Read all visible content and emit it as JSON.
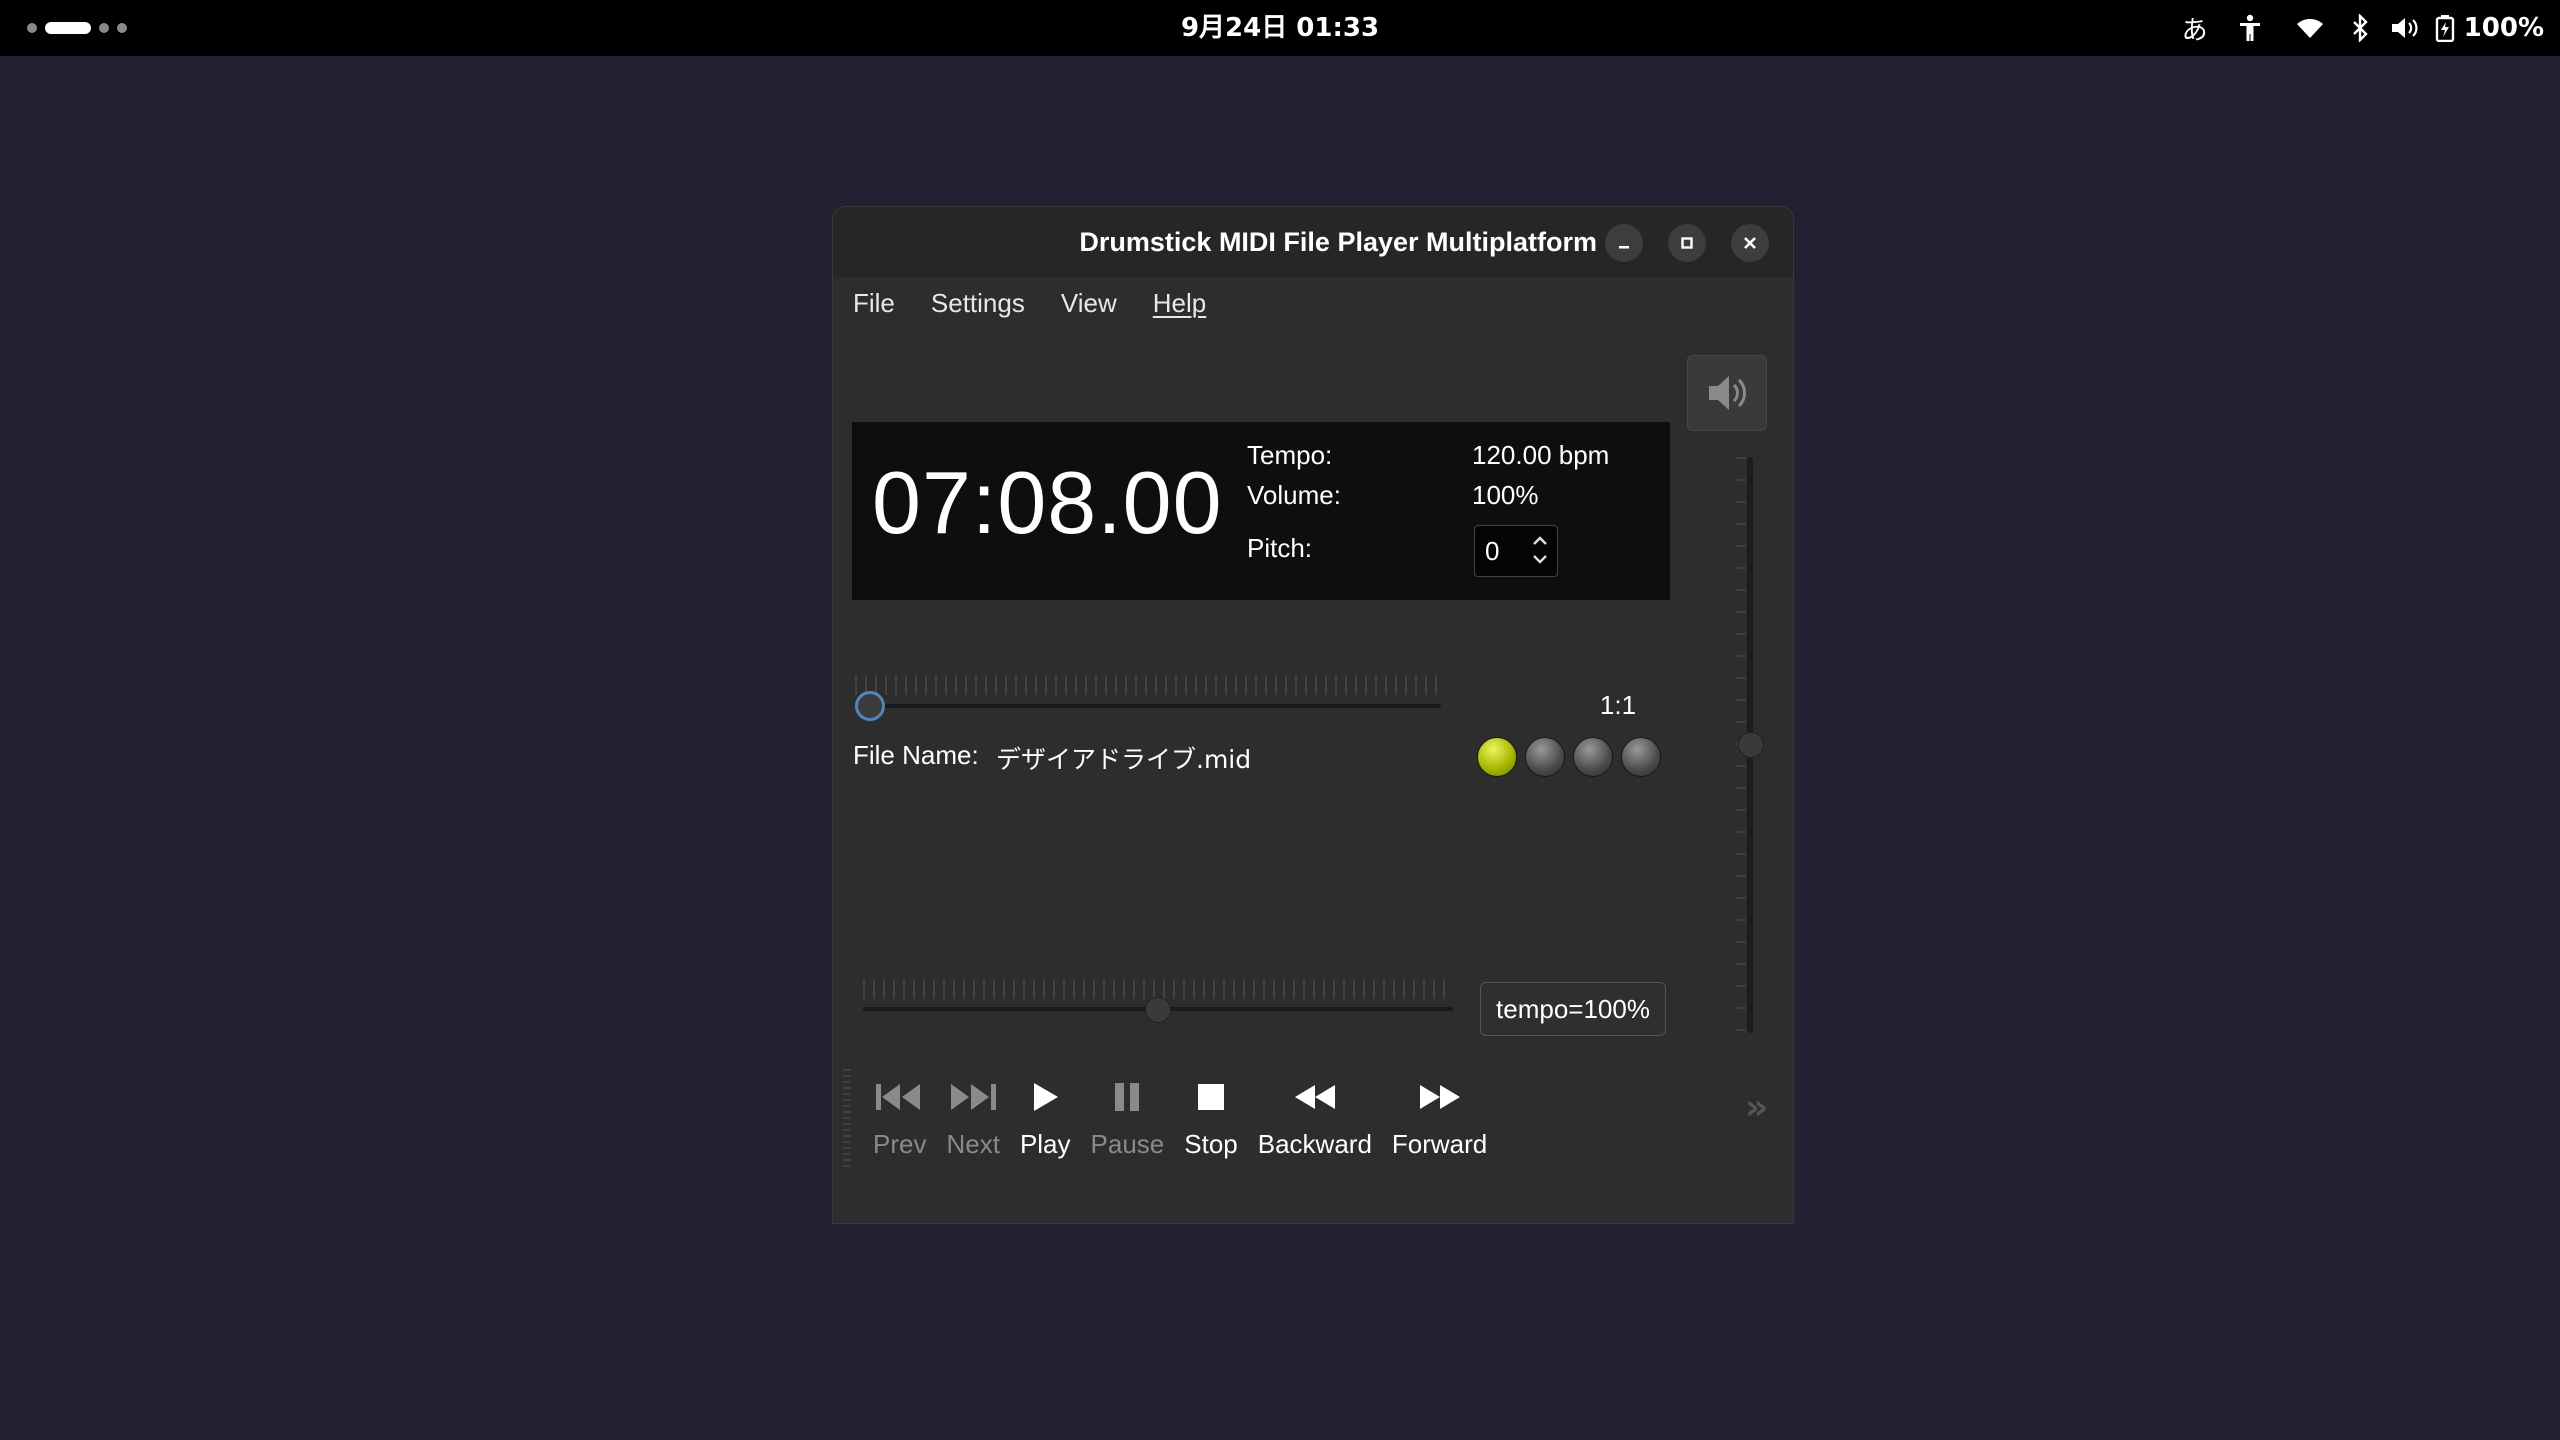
{
  "topbar": {
    "clock": "9月24日 01:33",
    "input_method": "あ",
    "battery_label": "100%",
    "icons": [
      "accessibility-icon",
      "wifi-icon",
      "bluetooth-icon",
      "volume-icon",
      "battery-icon"
    ]
  },
  "window": {
    "title": "Drumstick MIDI File Player Multiplatform",
    "controls": [
      "minimize",
      "maximize",
      "close"
    ]
  },
  "menu": {
    "items": [
      "File",
      "Settings",
      "View",
      "Help"
    ]
  },
  "lcd": {
    "time": "07:08.00",
    "tempo_label": "Tempo:",
    "tempo_value": "120.00 bpm",
    "volume_label": "Volume:",
    "volume_value": "100%",
    "pitch_label": "Pitch:",
    "pitch_value": "0"
  },
  "position": {
    "progress": 0.0,
    "bar_beat": "1:1",
    "file_name_label": "File Name:",
    "file_name": "デザイアドライブ.mid",
    "beats_total": 4,
    "beat_active": 1
  },
  "tempo": {
    "slider_position": 0.5,
    "reset_label": "tempo=100%"
  },
  "volume": {
    "slider_position": 0.5
  },
  "toolbar": {
    "buttons": [
      {
        "label": "Prev",
        "icon": "skip-back-icon",
        "enabled": false
      },
      {
        "label": "Next",
        "icon": "skip-forward-icon",
        "enabled": false
      },
      {
        "label": "Play",
        "icon": "play-icon",
        "enabled": true
      },
      {
        "label": "Pause",
        "icon": "pause-icon",
        "enabled": false
      },
      {
        "label": "Stop",
        "icon": "stop-icon",
        "enabled": true
      },
      {
        "label": "Backward",
        "icon": "rewind-icon",
        "enabled": true
      },
      {
        "label": "Forward",
        "icon": "fast-forward-icon",
        "enabled": true
      }
    ],
    "extension_icon": "chevron-double-right-icon"
  },
  "colors": {
    "desktop": "#241f31",
    "window_bg": "#2d2d2d",
    "lcd_bg": "#0e0e0e",
    "led_on": "#a8b800",
    "accent": "#4e87b9"
  }
}
